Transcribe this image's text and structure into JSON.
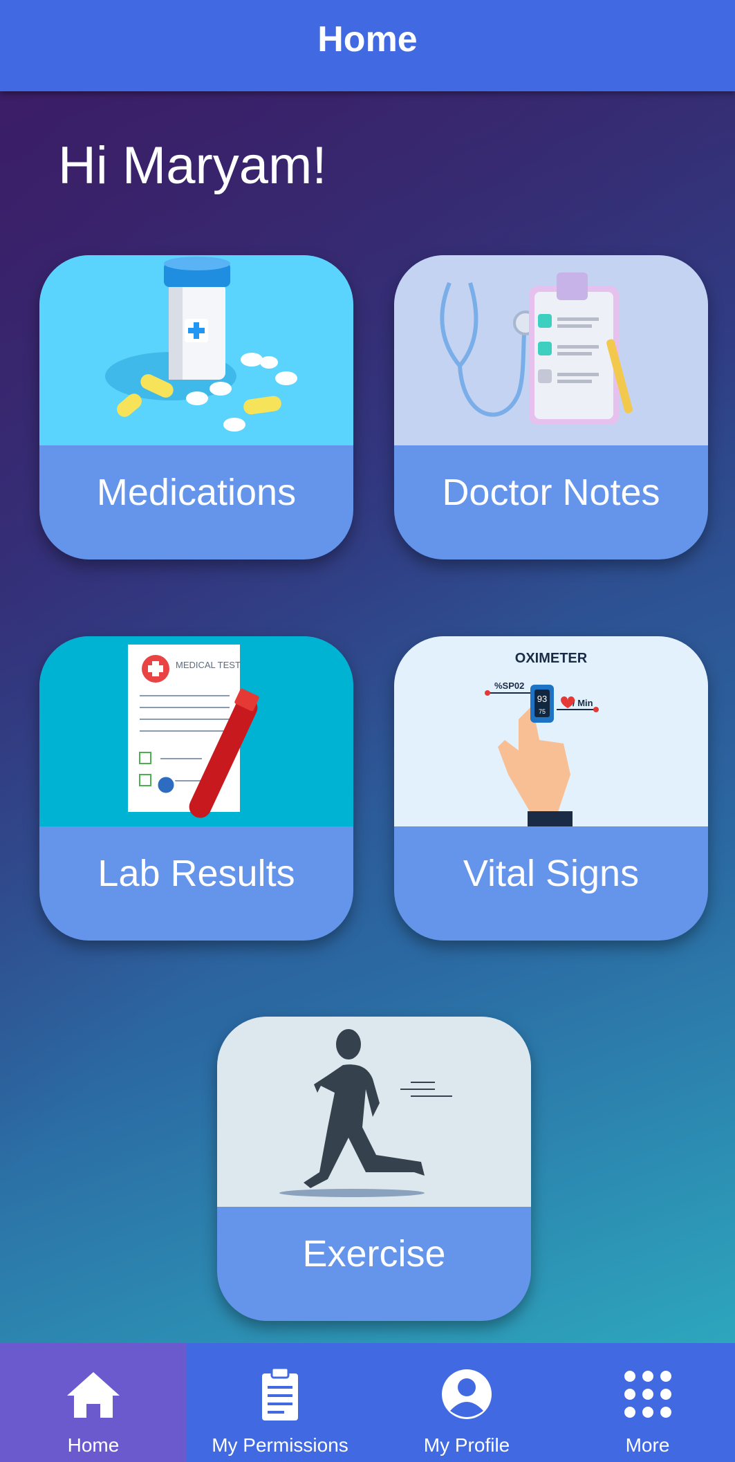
{
  "header": {
    "title": "Home"
  },
  "greeting": "Hi Maryam!",
  "cards": {
    "medications": {
      "label": "Medications"
    },
    "doctor_notes": {
      "label": "Doctor Notes"
    },
    "lab_results": {
      "label": "Lab Results",
      "art_text": "MEDICAL TEST"
    },
    "vital_signs": {
      "label": "Vital Signs",
      "art_title": "OXIMETER",
      "art_spo2": "%SP02",
      "art_rate": "/ Min",
      "art_value_1": "93",
      "art_value_2": "75"
    },
    "exercise": {
      "label": "Exercise"
    }
  },
  "bottom_nav": {
    "home": "Home",
    "my_permissions": "My Permissions",
    "my_profile": "My Profile",
    "more": "More"
  },
  "colors": {
    "app_bar": "#4169e1",
    "card_label_bg": "#6595ea",
    "nav_active": "#6a5acd"
  }
}
